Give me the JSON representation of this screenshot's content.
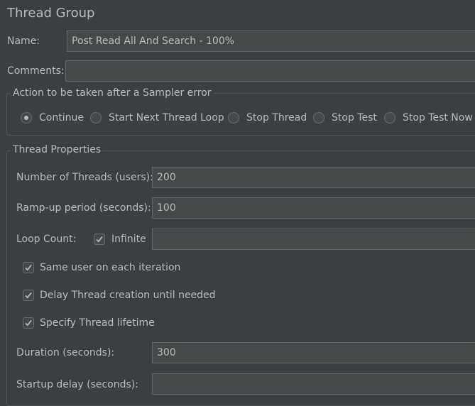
{
  "panel": {
    "title": "Thread Group"
  },
  "name": {
    "label": "Name:",
    "value": "Post Read All And Search - 100%"
  },
  "comments": {
    "label": "Comments:",
    "value": ""
  },
  "sampler_error": {
    "group_title": "Action to be taken after a Sampler error",
    "options": [
      {
        "label": "Continue",
        "selected": true
      },
      {
        "label": "Start Next Thread Loop",
        "selected": false
      },
      {
        "label": "Stop Thread",
        "selected": false
      },
      {
        "label": "Stop Test",
        "selected": false
      },
      {
        "label": "Stop Test Now",
        "selected": false
      }
    ]
  },
  "thread_properties": {
    "group_title": "Thread Properties",
    "num_threads": {
      "label": "Number of Threads (users):",
      "value": "200"
    },
    "ramp_up": {
      "label": "Ramp-up period (seconds):",
      "value": "100"
    },
    "loop_count": {
      "label": "Loop Count:",
      "infinite_label": "Infinite",
      "infinite_checked": true,
      "value": ""
    },
    "same_user": {
      "label": "Same user on each iteration",
      "checked": true
    },
    "delay_creation": {
      "label": "Delay Thread creation until needed",
      "checked": true
    },
    "specify_lifetime": {
      "label": "Specify Thread lifetime",
      "checked": true
    },
    "duration": {
      "label": "Duration (seconds):",
      "value": "300"
    },
    "startup_delay": {
      "label": "Startup delay (seconds):",
      "value": ""
    }
  }
}
